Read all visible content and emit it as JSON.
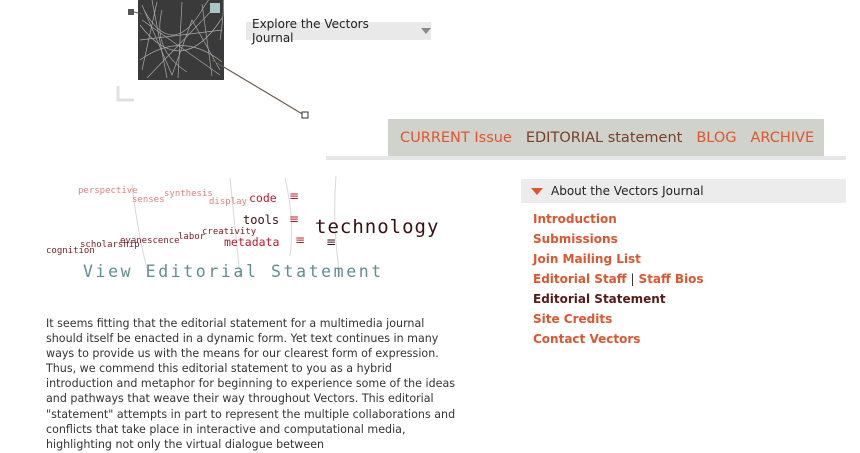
{
  "explore": {
    "label": "Explore the Vectors Journal",
    "icon": "caret-down-icon"
  },
  "nav": {
    "items": [
      {
        "label": "CURRENT Issue",
        "current": false
      },
      {
        "label": "EDITORIAL statement",
        "current": true
      },
      {
        "label": "BLOG",
        "current": false
      },
      {
        "label": "ARCHIVE",
        "current": false
      }
    ]
  },
  "cloud": {
    "words": {
      "perspective": "perspective",
      "synthesis": "synthesis",
      "senses": "senses",
      "display": "display",
      "code": "code",
      "tools": "tools",
      "technology": "technology",
      "creativity": "creativity",
      "labor": "labor",
      "evanescence": "evanescence",
      "scholarship": "scholarship",
      "cognition": "cognition",
      "metadata": "metadata"
    },
    "view_statement": "View Editorial Statement"
  },
  "body_text": "It seems fitting that the editorial statement for a multimedia journal should itself be enacted in a dynamic form. Yet text continues in many ways to provide us with the means for our clearest form of expression. Thus, we commend this editorial statement to you as a hybrid introduction and metaphor for beginning to experience some of the ideas and pathways that weave their way throughout Vectors. This editorial \"statement\" attempts in part to represent the multiple collaborations and conflicts that take place in interactive and computational media, highlighting not only the virtual dialogue between",
  "sidebar": {
    "header": "About the Vectors Journal",
    "items": {
      "introduction": "Introduction",
      "submissions": "Submissions",
      "mailing": "Join Mailing List",
      "staff": "Editorial Staff",
      "separator": "|",
      "bios": "Staff Bios",
      "statement": "Editorial Statement",
      "credits": "Site Credits",
      "contact": "Contact Vectors"
    }
  },
  "colors": {
    "accent": "#e0552e",
    "nav_bg": "#cfd3cc",
    "dark_red": "#5a1a1a",
    "teal": "#5f8f92"
  }
}
